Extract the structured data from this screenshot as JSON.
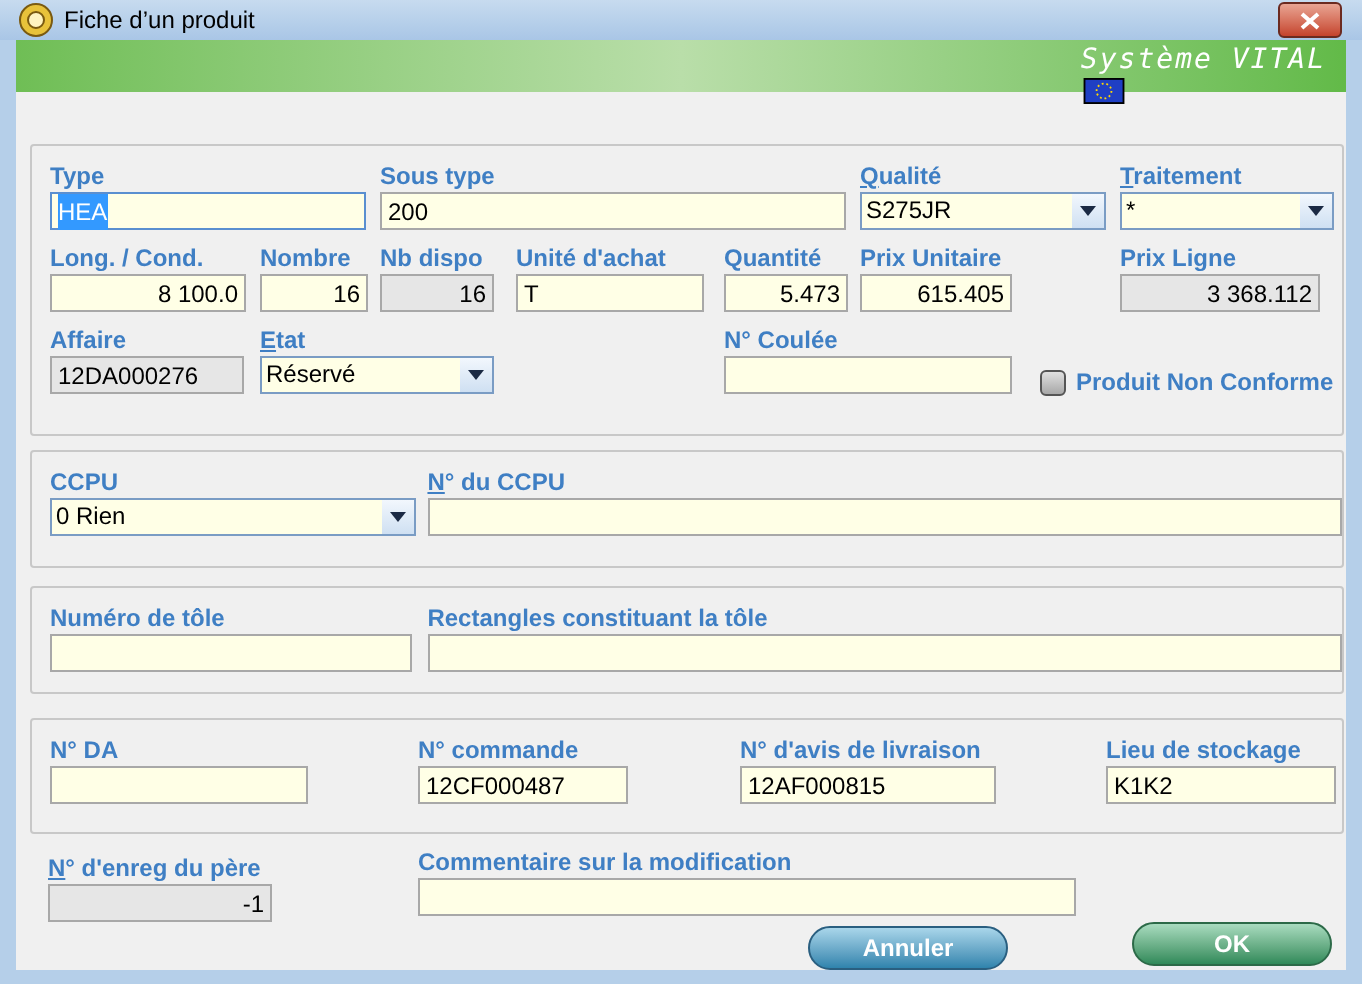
{
  "window": {
    "title": "Fiche d’un produit"
  },
  "banner": {
    "title": "Système VITAL"
  },
  "groups": [
    {
      "fields": [
        {
          "label": "Type",
          "mnemonic": false,
          "kind": "text",
          "value": "HEA",
          "disabled": false,
          "highlighted": true
        },
        {
          "label": "Sous type",
          "mnemonic": false,
          "kind": "text",
          "value": "200",
          "disabled": false,
          "highlighted": false
        },
        {
          "label": "Qualité",
          "mnemonic": true,
          "kind": "combo",
          "value": "S275JR"
        },
        {
          "label": "Traitement",
          "mnemonic": true,
          "kind": "combo",
          "value": "*"
        },
        {
          "label": "Long. / Cond.",
          "mnemonic": false,
          "kind": "number",
          "value": "8 100.0",
          "disabled": false,
          "highlighted": false
        },
        {
          "label": "Nombre",
          "mnemonic": false,
          "kind": "number",
          "value": "16",
          "disabled": false,
          "highlighted": false
        },
        {
          "label": "Nb dispo",
          "mnemonic": false,
          "kind": "number",
          "value": "16",
          "disabled": true,
          "highlighted": false
        },
        {
          "label": "Unité d'achat",
          "mnemonic": false,
          "kind": "text",
          "value": "T",
          "disabled": false,
          "highlighted": false
        },
        {
          "label": "Quantité",
          "mnemonic": false,
          "kind": "number",
          "value": "5.473",
          "disabled": false,
          "highlighted": false
        },
        {
          "label": "Prix Unitaire",
          "mnemonic": false,
          "kind": "number",
          "value": "615.405",
          "disabled": false,
          "highlighted": false
        },
        {
          "label": "Prix Ligne",
          "mnemonic": false,
          "kind": "number",
          "value": "3 368.112",
          "disabled": true,
          "highlighted": false
        },
        {
          "label": "Affaire",
          "mnemonic": false,
          "kind": "text",
          "value": "12DA000276",
          "disabled": true,
          "highlighted": false
        },
        {
          "label": "Etat",
          "mnemonic": true,
          "kind": "combo",
          "value": "Réservé"
        },
        {
          "label": "N° Coulée",
          "mnemonic": false,
          "kind": "text",
          "disabled": false,
          "highlighted": false
        },
        {
          "label": "Produit Non Conforme",
          "kind": "checkbox",
          "checked": false
        }
      ]
    },
    {
      "fields": [
        {
          "label": "CCPU",
          "mnemonic": false,
          "kind": "combo",
          "value": "0 Rien"
        },
        {
          "label": "N° du CCPU",
          "mnemonic": true,
          "kind": "text",
          "disabled": false,
          "highlighted": false
        }
      ]
    },
    {
      "fields": [
        {
          "label": "Numéro de tôle",
          "mnemonic": false,
          "kind": "text",
          "disabled": false,
          "highlighted": false
        },
        {
          "label": "Rectangles constituant la tôle",
          "mnemonic": false,
          "kind": "text",
          "disabled": false,
          "highlighted": false
        }
      ]
    },
    {
      "fields": [
        {
          "label": "N° DA",
          "mnemonic": false,
          "kind": "text",
          "disabled": false,
          "highlighted": false
        },
        {
          "label": "N° commande",
          "mnemonic": false,
          "kind": "text",
          "value": "12CF000487",
          "disabled": false,
          "highlighted": false
        },
        {
          "label": "N° d'avis de livraison",
          "mnemonic": false,
          "kind": "text",
          "value": "12AF000815",
          "disabled": false,
          "highlighted": false
        },
        {
          "label": "Lieu de stockage",
          "mnemonic": false,
          "kind": "text",
          "value": "K1K2",
          "disabled": false,
          "highlighted": false
        }
      ]
    }
  ],
  "footer": {
    "fields": [
      {
        "label": "N° d'enreg du père",
        "mnemonic": true,
        "kind": "number",
        "value": "-1",
        "disabled": true,
        "highlighted": false
      },
      {
        "label": "Commentaire sur la modification",
        "mnemonic": false,
        "kind": "text",
        "disabled": false,
        "highlighted": false
      }
    ]
  },
  "buttons": [
    {
      "label": "Annuler",
      "kind": "cancel"
    },
    {
      "label": "OK",
      "kind": "ok"
    }
  ]
}
